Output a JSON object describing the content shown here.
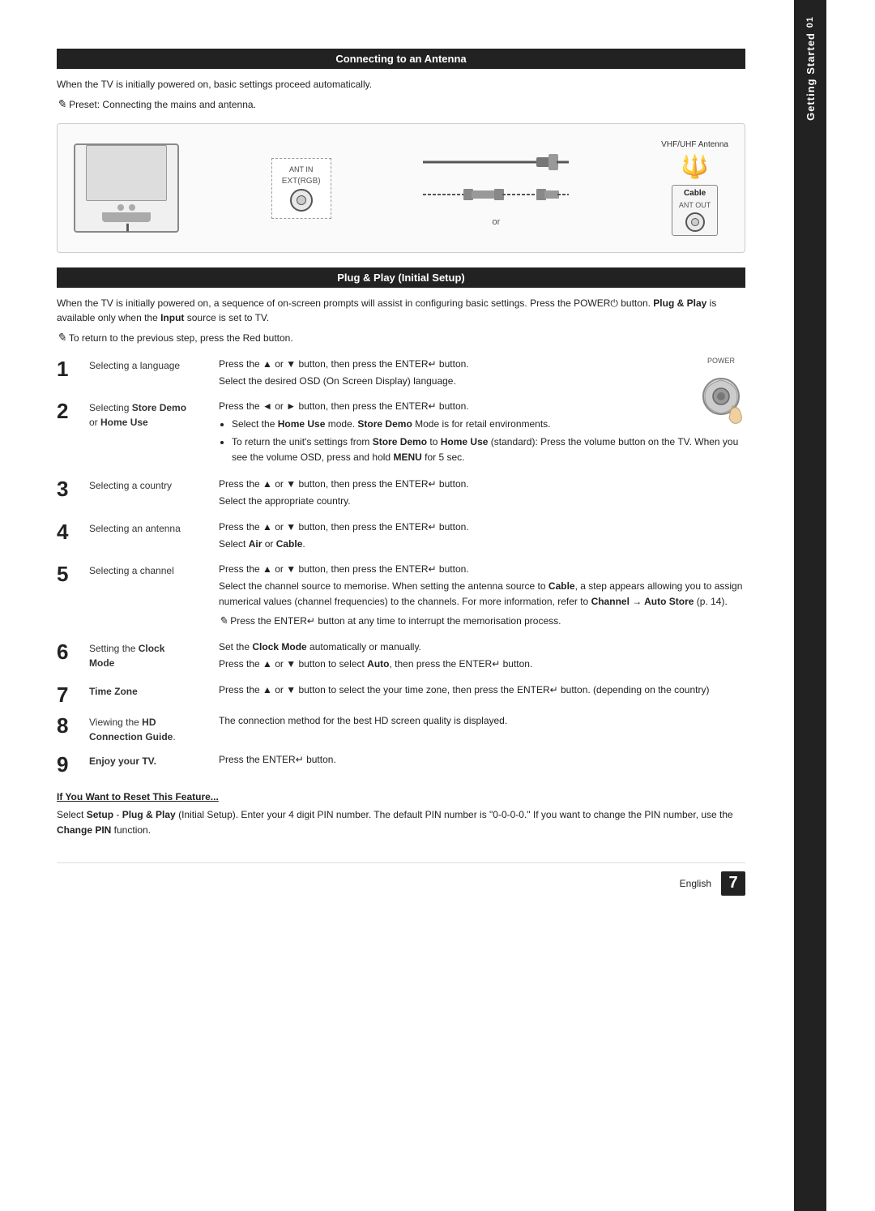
{
  "sidebar": {
    "number": "01",
    "title": "Getting Started"
  },
  "section1": {
    "title": "Connecting to an Antenna",
    "intro": "When the TV is initially powered on, basic settings proceed automatically.",
    "note": "Preset: Connecting the mains and antenna.",
    "diagram": {
      "antenna_label": "VHF/UHF Antenna",
      "cable_label": "Cable",
      "ant_in_label": "ANT IN",
      "ant_out_label": "ANT OUT",
      "or_text": "or"
    }
  },
  "section2": {
    "title": "Plug & Play (Initial Setup)",
    "intro": "When the TV is initially powered on, a sequence of on-screen prompts will assist in configuring basic settings. Press the POWER button. Plug & Play is available only when the Input source is set to TV.",
    "note": "To return to the previous step, press the Red button.",
    "steps": [
      {
        "number": "1",
        "label": "Selecting a language",
        "desc": "Press the ▲ or ▼ button, then press the ENTER↵ button.\nSelect the desired OSD (On Screen Display) language."
      },
      {
        "number": "2",
        "label": "Selecting Store Demo or Home Use",
        "label_line1": "Selecting",
        "label_bold1": "Store Demo",
        "label_line2": "or",
        "label_bold2": "Home Use",
        "desc_line1": "Press the ◄ or ► button, then press the ENTER↵ button.",
        "bullet1": "Select the Home Use mode. Store Demo Mode is for retail environments.",
        "bullet2": "To return the unit's settings from Store Demo to Home Use (standard): Press the volume button on the TV. When you see the volume OSD, press and hold MENU for 5 sec."
      },
      {
        "number": "3",
        "label": "Selecting a country",
        "desc_line1": "Press the ▲ or ▼ button, then press the ENTER↵ button.",
        "desc_line2": "Select the appropriate country."
      },
      {
        "number": "4",
        "label": "Selecting an antenna",
        "desc_line1": "Press the ▲ or ▼ button, then press the ENTER↵ button.",
        "desc_line2": "Select Air or Cable."
      },
      {
        "number": "5",
        "label": "Selecting a channel",
        "desc_line1": "Press the ▲ or ▼ button, then press the ENTER↵ button.",
        "desc_line2": "Select the channel source to memorise. When setting the antenna source to Cable, a step appears allowing you to assign numerical values (channel frequencies) to the channels. For more information, refer to Channel → Auto Store (p. 14).",
        "note": "Press the ENTER↵ button at any time to interrupt the memorisation process."
      },
      {
        "number": "6",
        "label": "Setting the Clock Mode",
        "label_line1": "Setting the",
        "label_bold": "Clock Mode",
        "desc_line1": "Set the Clock Mode automatically or manually.",
        "desc_line2": "Press the ▲ or ▼ button to select Auto, then press the ENTER↵ button."
      },
      {
        "number": "7",
        "label": "Time Zone",
        "label_bold": "Time Zone",
        "desc_line1": "Press the ▲ or ▼ button to select the your time zone, then press the ENTER↵ button. (depending on the country)"
      },
      {
        "number": "8",
        "label": "Viewing the HD Connection Guide.",
        "label_line1": "Viewing the",
        "label_bold": "HD Connection Guide.",
        "desc_line1": "The connection method for the best HD screen quality is displayed."
      },
      {
        "number": "9",
        "label": "Enjoy your TV.",
        "label_bold": "Enjoy your TV.",
        "desc_line1": "Press the ENTER↵ button."
      }
    ]
  },
  "reset_section": {
    "title": "If You Want to Reset This Feature...",
    "text": "Select Setup - Plug & Play (Initial Setup). Enter your 4 digit PIN number. The default PIN number is \"0-0-0-0.\" If you want to change the PIN number, use the Change PIN function."
  },
  "footer": {
    "lang": "English",
    "page": "7"
  }
}
